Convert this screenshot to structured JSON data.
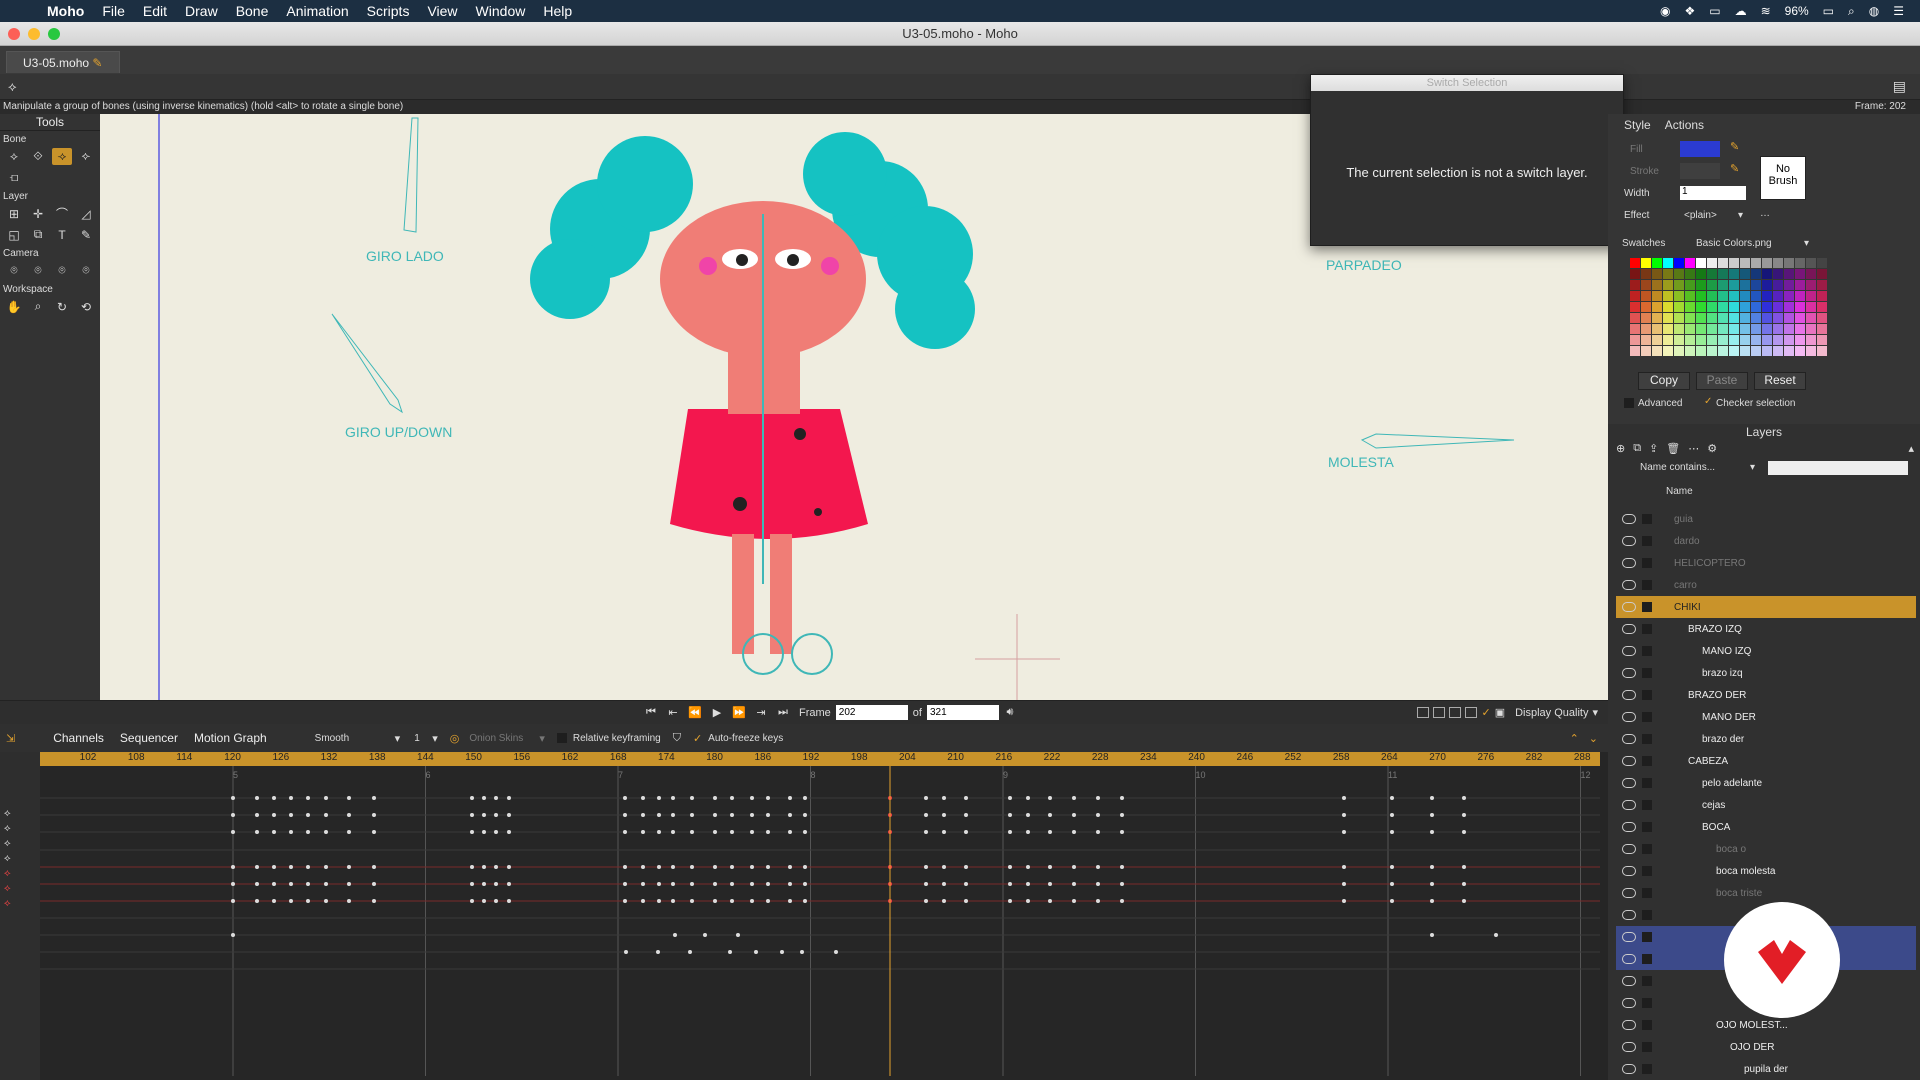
{
  "menubar": {
    "app": "Moho",
    "items": [
      "File",
      "Edit",
      "Draw",
      "Bone",
      "Animation",
      "Scripts",
      "View",
      "Window",
      "Help"
    ],
    "battery": "96%"
  },
  "window": {
    "title": "U3-05.moho - Moho",
    "tab": "U3-05.moho"
  },
  "status": {
    "hint": "Manipulate a group of bones (using inverse kinematics) (hold <alt> to rotate a single bone)",
    "frame_label": "Frame: 202"
  },
  "tools": {
    "title": "Tools",
    "sections": [
      "Bone",
      "Layer",
      "Camera",
      "Workspace"
    ]
  },
  "canvas": {
    "labels": [
      "GIRO LADO",
      "GIRO UP/DOWN",
      "PARPADEO",
      "MOLESTA"
    ]
  },
  "playback": {
    "frame_label": "Frame",
    "frame_value": "202",
    "of_label": "of",
    "total": "321",
    "display_quality": "Display Quality"
  },
  "timeline": {
    "tabs": [
      "Channels",
      "Sequencer",
      "Motion Graph"
    ],
    "interp": "Smooth",
    "interp_num": "1",
    "onion": "Onion Skins",
    "relative": "Relative keyframing",
    "autofreeze": "Auto-freeze keys",
    "ruler": [
      "102",
      "108",
      "114",
      "120",
      "126",
      "132",
      "138",
      "144",
      "150",
      "156",
      "162",
      "168",
      "174",
      "180",
      "186",
      "192",
      "198",
      "204",
      "210",
      "216",
      "222",
      "228",
      "234",
      "240",
      "246",
      "252",
      "258",
      "264",
      "270",
      "276",
      "282",
      "288"
    ],
    "markers": [
      "5",
      "6",
      "7",
      "8",
      "9",
      "10",
      "11",
      "12"
    ]
  },
  "dialog": {
    "title": "Switch Selection",
    "message": "The current selection is not a switch layer."
  },
  "style": {
    "tabs": [
      "Style",
      "Actions"
    ],
    "fill": "Fill",
    "stroke": "Stroke",
    "width": "Width",
    "width_value": "1",
    "effect": "Effect",
    "effect_value": "<plain>",
    "no_brush": "No Brush",
    "swatches": "Swatches",
    "swatches_file": "Basic Colors.png",
    "copy": "Copy",
    "paste": "Paste",
    "reset": "Reset",
    "advanced": "Advanced",
    "checker": "Checker selection",
    "fill_color": "#2b3bd1",
    "stroke_color": "#3f3f3f"
  },
  "layers": {
    "title": "Layers",
    "filter": "Name contains...",
    "col_name": "Name",
    "rows": [
      {
        "name": "guia",
        "indent": 0,
        "dim": true
      },
      {
        "name": "dardo",
        "indent": 0,
        "dim": true
      },
      {
        "name": "HELICOPTERO",
        "indent": 0,
        "dim": true
      },
      {
        "name": "carro",
        "indent": 0,
        "dim": true
      },
      {
        "name": "CHIKI",
        "indent": 0,
        "sel": true
      },
      {
        "name": "BRAZO IZQ",
        "indent": 1
      },
      {
        "name": "MANO IZQ",
        "indent": 2
      },
      {
        "name": "brazo izq",
        "indent": 2
      },
      {
        "name": "BRAZO DER",
        "indent": 1
      },
      {
        "name": "MANO DER",
        "indent": 2
      },
      {
        "name": "brazo der",
        "indent": 2
      },
      {
        "name": "CABEZA",
        "indent": 1
      },
      {
        "name": "pelo adelante",
        "indent": 2
      },
      {
        "name": "cejas",
        "indent": 2
      },
      {
        "name": "BOCA",
        "indent": 2
      },
      {
        "name": "boca o",
        "indent": 3,
        "dim": true
      },
      {
        "name": "boca molesta",
        "indent": 3
      },
      {
        "name": "boca triste",
        "indent": 3,
        "dim": true
      },
      {
        "name": "",
        "indent": 3,
        "dim": true
      },
      {
        "name": "",
        "indent": 2,
        "blue": true
      },
      {
        "name": "",
        "indent": 2,
        "blue": true
      },
      {
        "name": "",
        "indent": 2
      },
      {
        "name": "",
        "indent": 2
      },
      {
        "name": "OJO MOLEST...",
        "indent": 3
      },
      {
        "name": "OJO DER",
        "indent": 4
      },
      {
        "name": "pupila der",
        "indent": 5
      }
    ]
  }
}
